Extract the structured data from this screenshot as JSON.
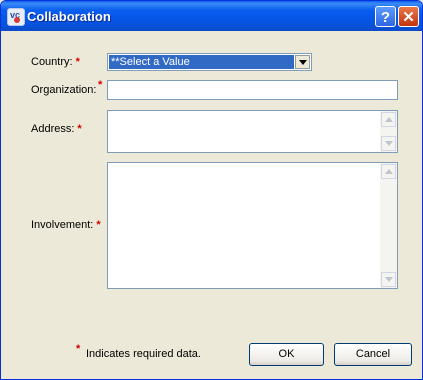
{
  "window": {
    "title": "Collaboration",
    "icon": "app-icon",
    "help_glyph": "?",
    "close_glyph": "✕"
  },
  "form": {
    "required_marker": "*",
    "country_label": "Country:",
    "country_value": "**Select a Value",
    "organization_label": "Organization:",
    "organization_value": "",
    "address_label": "Address:",
    "address_value": "",
    "involvement_label": "Involvement:",
    "involvement_value": ""
  },
  "footer": {
    "required_note": "Indicates required data.",
    "ok_label": "OK",
    "cancel_label": "Cancel"
  },
  "colors": {
    "titlebar": "#0a5ef0",
    "background": "#ece9d8",
    "selection": "#316ac5",
    "required": "#d40000"
  }
}
